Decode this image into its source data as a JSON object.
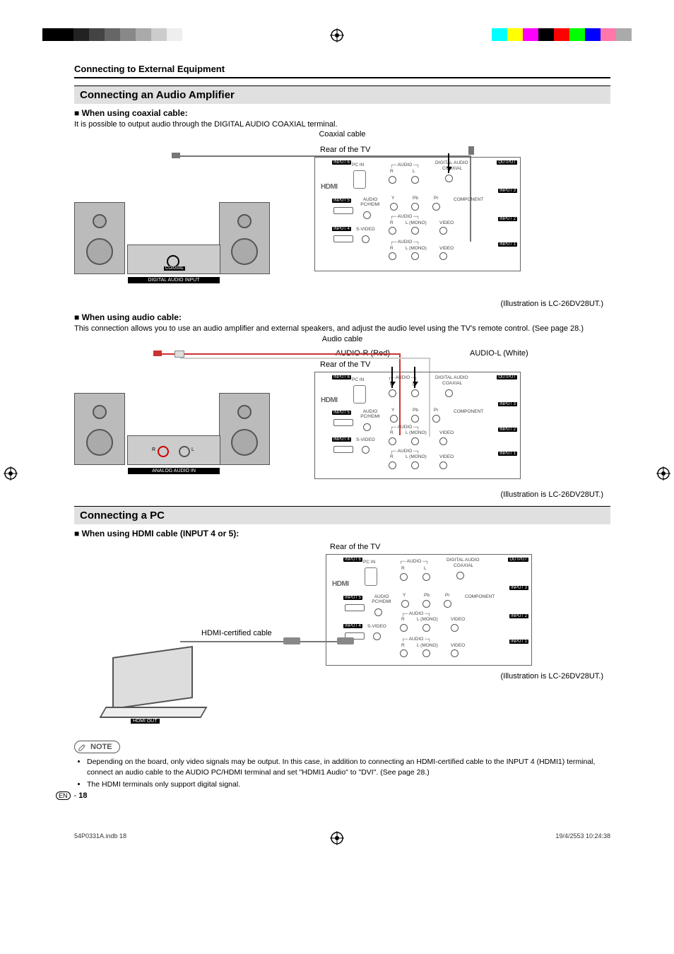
{
  "header": {
    "section_title": "Connecting to External Equipment"
  },
  "sec1": {
    "heading": "Connecting an Audio Amplifier",
    "sub1": "When using coaxial cable:",
    "body1": "It is possible to output audio through the DIGITAL AUDIO COAXIAL terminal.",
    "cable_label": "Coaxial cable",
    "rear_label": "Rear of the TV",
    "amp_label": "DIGITAL AUDIO INPUT",
    "amp_sub": "COAXIAL",
    "illus_note": "(Illustration is LC-26DV28UT.)",
    "sub2": "When using audio cable:",
    "body2": "This connection allows you to use an audio amplifier and external speakers, and adjust the audio level using the TV's remote control. (See page 28.)",
    "cable_label2": "Audio cable",
    "audio_r": "AUDIO-R (Red)",
    "audio_l": "AUDIO-L (White)",
    "amp_label2": "ANALOG AUDIO IN",
    "amp_r": "R",
    "amp_l": "L"
  },
  "sec2": {
    "heading": "Connecting a PC",
    "sub1": "When using HDMI cable (INPUT 4 or 5):",
    "rear_label": "Rear of the TV",
    "hdmi_cable": "HDMI-certified cable",
    "laptop_out": "HDMI OUT",
    "illus_note": "(Illustration is LC-26DV28UT.)"
  },
  "note": {
    "label": "NOTE",
    "items": [
      "Depending on the board, only video signals may be output. In this case, in addition to connecting an HDMI-certified cable to the INPUT 4 (HDMI1) terminal, connect an audio cable to the AUDIO PC/HDMI terminal and set \"HDMI1 Audio\" to \"DVI\". (See page 28.)",
      "The HDMI terminals only support digital signal."
    ]
  },
  "page_num": {
    "lang": "EN",
    "num": "18"
  },
  "footer": {
    "file": "54P0331A.indb   18",
    "date": "19/4/2553   10:24:38"
  },
  "tvports": {
    "input6": "INPUT 6",
    "input5": "INPUT 5",
    "input4": "INPUT 4",
    "input3": "INPUT 3",
    "input2": "INPUT 2",
    "input1": "INPUT 1",
    "output": "OUTPUT",
    "pc_in": "PC IN",
    "audio": "AUDIO",
    "audio_r": "R",
    "audio_l": "L",
    "digital_audio": "DIGITAL AUDIO",
    "coaxial": "COAXIAL",
    "audio_pchdmi": "AUDIO\nPC/HDMI",
    "svideo": "S-VIDEO",
    "component": "COMPONENT",
    "y": "Y",
    "pb": "Pb",
    "pr": "Pr",
    "lmono": "L (MONO)",
    "video": "VIDEO",
    "hdmi": "HDMI"
  }
}
